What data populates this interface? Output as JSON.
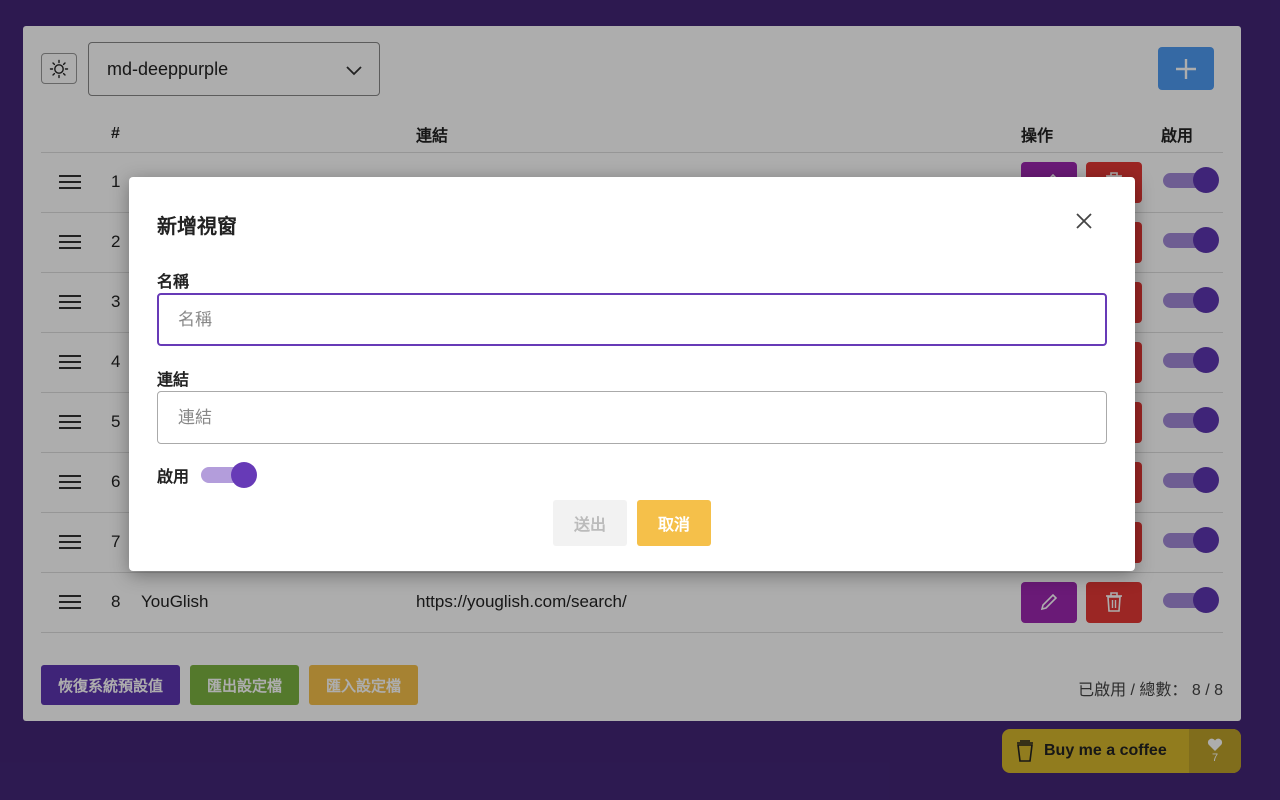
{
  "toolbar": {
    "theme_select_value": "md-deeppurple",
    "add_icon": "plus-icon",
    "theme_icon": "sun-icon"
  },
  "table": {
    "headers": {
      "num": "#",
      "name": "",
      "link": "連結",
      "ops": "操作",
      "enabled": "啟用"
    },
    "rows": [
      {
        "num": "1",
        "name": "",
        "link": "",
        "enabled": true
      },
      {
        "num": "2",
        "name": "",
        "link": "",
        "enabled": true
      },
      {
        "num": "3",
        "name": "",
        "link": "",
        "enabled": true
      },
      {
        "num": "4",
        "name": "",
        "link": "",
        "enabled": true
      },
      {
        "num": "5",
        "name": "",
        "link": "",
        "enabled": true
      },
      {
        "num": "6",
        "name": "",
        "link": "",
        "enabled": true
      },
      {
        "num": "7",
        "name": "",
        "link": "",
        "enabled": true
      },
      {
        "num": "8",
        "name": "YouGlish",
        "link": "https://youglish.com/search/",
        "enabled": true
      }
    ]
  },
  "footer": {
    "restore_label": "恢復系統預設值",
    "export_label": "匯出設定檔",
    "import_label": "匯入設定檔",
    "stats_label": "已啟用 / 總數：",
    "stats_value": "8 / 8"
  },
  "modal": {
    "title": "新增視窗",
    "name_label": "名稱",
    "name_placeholder": "名稱",
    "link_label": "連結",
    "link_placeholder": "連結",
    "enabled_label": "啟用",
    "enabled": true,
    "submit_label": "送出",
    "cancel_label": "取消"
  },
  "coffee": {
    "label": "Buy me a coffee",
    "likes": "7"
  },
  "colors": {
    "background": "#432677",
    "accent": "#673ab7",
    "add_button": "#4e9bf2",
    "edit_button": "#9c27b0",
    "delete_button": "#e53935",
    "restore_button": "#5e35b1",
    "export_button": "#7cb342",
    "import_button": "#f5c04a",
    "coffee": "#d6b72d"
  }
}
